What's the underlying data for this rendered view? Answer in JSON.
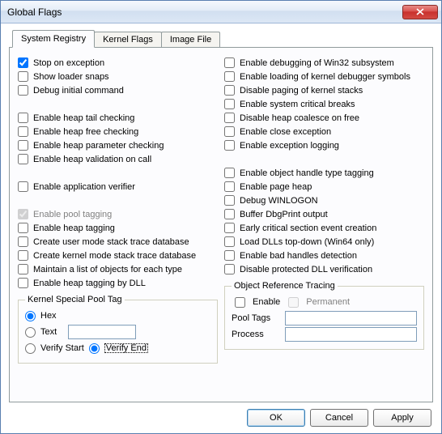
{
  "window": {
    "title": "Global Flags"
  },
  "tabs": [
    {
      "label": "System Registry",
      "active": true
    },
    {
      "label": "Kernel Flags"
    },
    {
      "label": "Image File"
    }
  ],
  "left": {
    "g1": [
      {
        "label": "Stop on exception",
        "checked": true
      },
      {
        "label": "Show loader snaps"
      },
      {
        "label": "Debug initial command"
      }
    ],
    "g2": [
      {
        "label": "Enable heap tail checking"
      },
      {
        "label": "Enable heap free checking"
      },
      {
        "label": "Enable heap parameter checking"
      },
      {
        "label": "Enable heap validation on call"
      }
    ],
    "g3": [
      {
        "label": "Enable application verifier"
      }
    ],
    "g4": [
      {
        "label": "Enable pool tagging",
        "checked": true,
        "disabled": true
      },
      {
        "label": "Enable heap tagging"
      },
      {
        "label": "Create user mode stack trace database"
      },
      {
        "label": "Create kernel mode stack trace database"
      },
      {
        "label": "Maintain a list of objects for each type"
      },
      {
        "label": "Enable heap tagging by DLL"
      }
    ]
  },
  "right": {
    "g1": [
      {
        "label": "Enable debugging of Win32 subsystem"
      },
      {
        "label": "Enable loading of kernel debugger symbols"
      },
      {
        "label": "Disable paging of kernel stacks"
      },
      {
        "label": "Enable system critical breaks"
      },
      {
        "label": "Disable heap coalesce on free"
      },
      {
        "label": "Enable close exception"
      },
      {
        "label": "Enable exception logging"
      }
    ],
    "g2": [
      {
        "label": "Enable object handle type tagging"
      },
      {
        "label": "Enable page heap"
      },
      {
        "label": "Debug WINLOGON"
      },
      {
        "label": "Buffer DbgPrint output"
      },
      {
        "label": "Early critical section event creation"
      },
      {
        "label": "Load DLLs top-down (Win64 only)"
      },
      {
        "label": "Enable bad handles detection"
      },
      {
        "label": "Disable protected DLL verification"
      }
    ]
  },
  "kspt": {
    "legend": "Kernel Special Pool Tag",
    "hex": "Hex",
    "text": "Text",
    "value": "",
    "verify_start": "Verify Start",
    "verify_end": "Verify End",
    "mode": "hex",
    "verify": "end"
  },
  "ort": {
    "legend": "Object Reference Tracing",
    "enable": "Enable",
    "permanent": "Permanent",
    "pool_tags": "Pool Tags",
    "process": "Process",
    "pool_tags_value": "",
    "process_value": ""
  },
  "buttons": {
    "ok": "OK",
    "cancel": "Cancel",
    "apply": "Apply"
  }
}
